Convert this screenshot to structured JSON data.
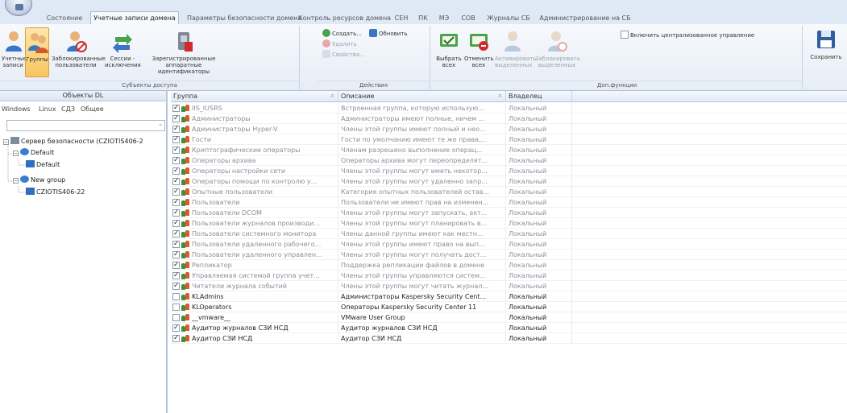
{
  "tabs": [
    {
      "label": "Состояние",
      "active": false
    },
    {
      "label": "Учетные записи домена",
      "active": true
    },
    {
      "label": "Параметры безопасности домена",
      "active": false
    },
    {
      "label": "Контроль ресурсов домена",
      "active": false
    },
    {
      "label": "СЕН",
      "active": false
    },
    {
      "label": "ПК",
      "active": false
    },
    {
      "label": "МЭ",
      "active": false
    },
    {
      "label": "СОВ",
      "active": false
    },
    {
      "label": "Журналы СБ",
      "active": false
    },
    {
      "label": "Администрирование на СБ",
      "active": false
    }
  ],
  "ribbon": {
    "subjects_caption": "Субъекты доступа",
    "accounts_label": "Учетные записи",
    "groups_label": "Группы",
    "blocked_label": "Заблокированные пользователи",
    "sessions_label": "Сессии - исключения",
    "registered_label": "Зарегистрированные аппаратные идентификаторы",
    "actions_caption": "Действия",
    "create_label": "Создать...",
    "refresh_label": "Обновить",
    "delete_label": "Удалить",
    "properties_label": "Свойства...",
    "select_all_label": "Выбрать всех",
    "deselect_all_label": "Отменить всех",
    "activate_selected_label": "Активировать выделенных",
    "block_selected_label": "Заблокировать выделенных",
    "central_mgmt_label": "Включить централизованное управление",
    "extra_caption": "Доп.функции",
    "save_label": "Сохранить"
  },
  "left_panel": {
    "header": "Объекты DL",
    "os_tabs": [
      "Windows",
      "Linux",
      "СДЗ",
      "Общее"
    ],
    "tree": {
      "root": "Сервер безопасности (CZIOTIS406-2",
      "group1": "Default",
      "group1_child": "Default",
      "group2": "New group",
      "group2_child": "CZIOTIS406-22"
    }
  },
  "grid": {
    "columns": [
      "Группа",
      "Описание",
      "Владелец"
    ],
    "rows": [
      {
        "checked": true,
        "dim": true,
        "name": "IIS_IUSRS",
        "description": "Встроенная группа, которую использую...",
        "owner": "Локальный"
      },
      {
        "checked": true,
        "dim": true,
        "name": "Администраторы",
        "description": "Администраторы имеют полные, ничем ...",
        "owner": "Локальный"
      },
      {
        "checked": true,
        "dim": true,
        "name": "Администраторы Hyper-V",
        "description": "Члены этой группы имеют полный и нео...",
        "owner": "Локальный"
      },
      {
        "checked": true,
        "dim": true,
        "name": "Гости",
        "description": "Гости по умолчанию имеют те же права,...",
        "owner": "Локальный"
      },
      {
        "checked": true,
        "dim": true,
        "name": "Криптографические операторы",
        "description": "Членам разрешено выполнение операц...",
        "owner": "Локальный"
      },
      {
        "checked": true,
        "dim": true,
        "name": "Операторы архива",
        "description": "Операторы архива могут переопределят...",
        "owner": "Локальный"
      },
      {
        "checked": true,
        "dim": true,
        "name": "Операторы настройки сети",
        "description": "Члены этой группы могут иметь некотор...",
        "owner": "Локальный"
      },
      {
        "checked": true,
        "dim": true,
        "name": "Операторы помощи по контролю у...",
        "description": "Члены этой группы могут удаленно запр...",
        "owner": "Локальный"
      },
      {
        "checked": true,
        "dim": true,
        "name": "Опытные пользователи",
        "description": "Категория опытных пользователей остав...",
        "owner": "Локальный"
      },
      {
        "checked": true,
        "dim": true,
        "name": "Пользователи",
        "description": "Пользователи не имеют прав на изменен...",
        "owner": "Локальный"
      },
      {
        "checked": true,
        "dim": true,
        "name": "Пользователи DCOM",
        "description": "Члены этой группы могут запускать, акт...",
        "owner": "Локальный"
      },
      {
        "checked": true,
        "dim": true,
        "name": "Пользователи журналов производи...",
        "description": "Члены этой группы могут планировать в...",
        "owner": "Локальный"
      },
      {
        "checked": true,
        "dim": true,
        "name": "Пользователи системного монитора",
        "description": "Члены данной группы имеют как местн...",
        "owner": "Локальный"
      },
      {
        "checked": true,
        "dim": true,
        "name": "Пользователи удаленного рабочего...",
        "description": "Члены этой группы имеют право на вып...",
        "owner": "Локальный"
      },
      {
        "checked": true,
        "dim": true,
        "name": "Пользователи удаленного управлен...",
        "description": "Члены этой группы могут получать дост...",
        "owner": "Локальный"
      },
      {
        "checked": true,
        "dim": true,
        "name": "Репликатор",
        "description": "Поддержка репликации файлов в домене",
        "owner": "Локальный"
      },
      {
        "checked": true,
        "dim": true,
        "name": "Управляемая системой группа учет...",
        "description": "Члены этой группы управляются систем...",
        "owner": "Локальный"
      },
      {
        "checked": true,
        "dim": true,
        "name": "Читатели журнала событий",
        "description": "Члены этой группы могут читать журнал...",
        "owner": "Локальный"
      },
      {
        "checked": false,
        "dim": false,
        "name": "KLAdmins",
        "description": "Администраторы Kaspersky Security Cent...",
        "owner": "Локальный"
      },
      {
        "checked": false,
        "dim": false,
        "name": "KLOperators",
        "description": "Операторы Kaspersky Security Center 11",
        "owner": "Локальный"
      },
      {
        "checked": false,
        "dim": false,
        "name": "__vmware__",
        "description": "VMware User Group",
        "owner": "Локальный"
      },
      {
        "checked": true,
        "dim": false,
        "name": "Аудитор журналов СЗИ НСД",
        "description": "Аудитор журналов СЗИ НСД",
        "owner": "Локальный"
      },
      {
        "checked": true,
        "dim": false,
        "name": "Аудитор СЗИ НСД",
        "description": "Аудитор СЗИ НСД",
        "owner": "Локальный"
      }
    ]
  }
}
